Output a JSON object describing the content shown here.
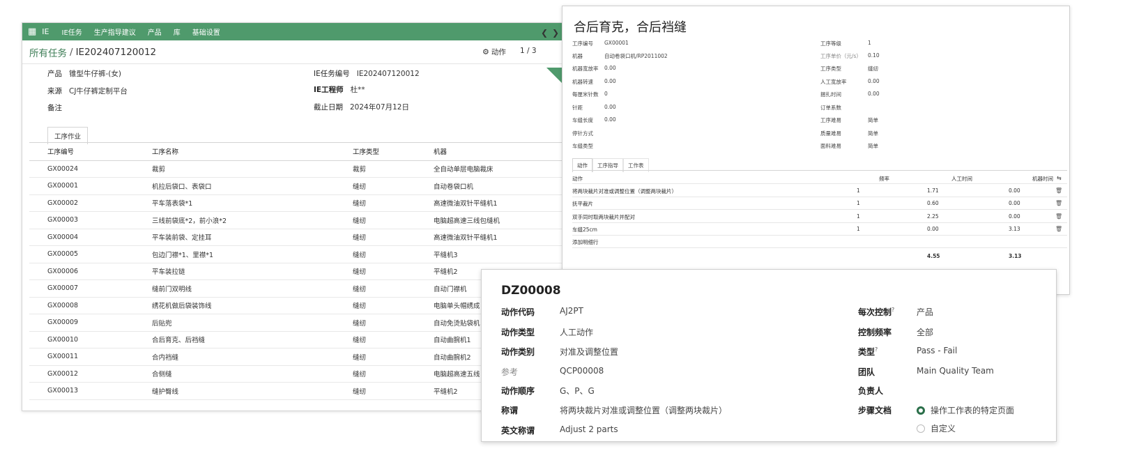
{
  "main": {
    "nav": {
      "apps_icon": "grid-icon",
      "app_name": "IE",
      "items": [
        "IE任务",
        "生产指导建议",
        "产品",
        "库",
        "基础设置"
      ]
    },
    "breadcrumb": {
      "root": "所有任务",
      "sep": "/",
      "current": "IE202407120012"
    },
    "actions_label": "动作",
    "pager": "1 / 3",
    "form": {
      "product_label": "产品",
      "product_value": "锥型牛仔裤-(女)",
      "source_label": "来源",
      "source_value": "CJ牛仔裤定制平台",
      "note_label": "备注",
      "task_no_label": "IE任务编号",
      "task_no_value": "IE202407120012",
      "engineer_label": "IE工程师",
      "engineer_value": "杜**",
      "deadline_label": "截止日期",
      "deadline_value": "2024年07月12日"
    },
    "tab": "工序作业",
    "table": {
      "headers": [
        "工序编号",
        "工序名称",
        "工序类型",
        "机器"
      ],
      "rows": [
        [
          "GX00024",
          "裁剪",
          "裁剪",
          "全自动单层电脑裁床"
        ],
        [
          "GX00001",
          "机拉后袋口、表袋口",
          "缝纫",
          "自动卷袋口机"
        ],
        [
          "GX00002",
          "平车落表袋*1",
          "缝纫",
          "高速微油双针平缝机1"
        ],
        [
          "GX00003",
          "三线前袋底*2，前小浪*2",
          "缝纫",
          "电脑超高速三线包缝机"
        ],
        [
          "GX00004",
          "平车装前袋、定挂耳",
          "缝纫",
          "高速微油双针平缝机1"
        ],
        [
          "GX00005",
          "包边门襟*1、里襟*1",
          "缝纫",
          "平缝机3"
        ],
        [
          "GX00006",
          "平车装拉链",
          "缝纫",
          "平缝机2"
        ],
        [
          "GX00007",
          "缝前门双明线",
          "缝纫",
          "自动门襟机"
        ],
        [
          "GX00008",
          "绣花机做后袋装饰线",
          "缝纫",
          "电脑单头帽绣成"
        ],
        [
          "GX00009",
          "后贴兜",
          "缝纫",
          "自动免烫贴袋机"
        ],
        [
          "GX00010",
          "合后育克、后裆缝",
          "缝纫",
          "自动曲腕机1"
        ],
        [
          "GX00011",
          "合内裆缝",
          "缝纫",
          "自动曲腕机2"
        ],
        [
          "GX00012",
          "合侧缝",
          "缝纫",
          "电脑超高速五线"
        ],
        [
          "GX00013",
          "缝护臀线",
          "缝纫",
          "平缝机2"
        ]
      ]
    }
  },
  "op": {
    "title": "合后育克，合后裆缝",
    "left_fields": [
      {
        "label": "工序编号",
        "value": "GX00001"
      },
      {
        "label": "机器",
        "value": "自动卷袋口机/RP2011002"
      },
      {
        "label": "机器宽放率",
        "value": "0.00"
      },
      {
        "label": "机器转速",
        "value": "0.00"
      },
      {
        "label": "每厘米针数",
        "value": "0"
      },
      {
        "label": "针距",
        "value": "0.00"
      },
      {
        "label": "车缝长度",
        "value": "0.00"
      },
      {
        "label": "停针方式",
        "value": ""
      },
      {
        "label": "车缝类型",
        "value": ""
      }
    ],
    "right_fields": [
      {
        "label": "工序等级",
        "value": "1"
      },
      {
        "label": "工序单价（元/s）",
        "value": "0.10"
      },
      {
        "label": "工序类型",
        "value": "缝纫"
      },
      {
        "label": "人工宽放率",
        "value": "0.00"
      },
      {
        "label": "捆扎时间",
        "value": "0.00"
      },
      {
        "label": "订单系数",
        "value": ""
      },
      {
        "label": "工序难易",
        "value": "简单"
      },
      {
        "label": "质量难易",
        "value": "简单"
      },
      {
        "label": "面料难易",
        "value": "简单"
      }
    ],
    "tabs": [
      "动作",
      "工序指导",
      "工作表"
    ],
    "table": {
      "headers": [
        "动作",
        "频率",
        "人工时间",
        "机器时间"
      ],
      "rows": [
        [
          "将两块裁片对准或调整位置（调整两块裁片）",
          "1",
          "1.71",
          "0.00"
        ],
        [
          "抚平裁片",
          "1",
          "0.60",
          "0.00"
        ],
        [
          "双手同时取两块裁片并配对",
          "1",
          "2.25",
          "0.00"
        ],
        [
          "车缝25cm",
          "1",
          "0.00",
          "3.13"
        ]
      ],
      "add_line": "添加明细行",
      "total_manual": "4.55",
      "total_machine": "3.13"
    }
  },
  "act": {
    "title": "DZ00008",
    "left": [
      {
        "label": "动作代码",
        "value": "AJ2PT"
      },
      {
        "label": "动作类型",
        "value": "人工动作"
      },
      {
        "label": "动作类别",
        "value": "对准及调整位置"
      },
      {
        "label": "参考",
        "value": "QCP00008"
      },
      {
        "label": "动作顺序",
        "value": "G、P、G"
      },
      {
        "label": "称谓",
        "value": "将两块裁片对准或调整位置（调整两块裁片）"
      },
      {
        "label": "英文称谓",
        "value": "Adjust 2 parts"
      }
    ],
    "right": [
      {
        "label": "每次控制",
        "value": "产品"
      },
      {
        "label": "控制频率",
        "value": "全部"
      },
      {
        "label": "类型",
        "value": "Pass - Fail"
      },
      {
        "label": "团队",
        "value": "Main Quality Team"
      },
      {
        "label": "负责人",
        "value": ""
      },
      {
        "label": "步骤文档",
        "value": ""
      }
    ],
    "help_mark": "?",
    "step_doc_options": [
      "操作工作表的特定页面",
      "自定义"
    ]
  }
}
